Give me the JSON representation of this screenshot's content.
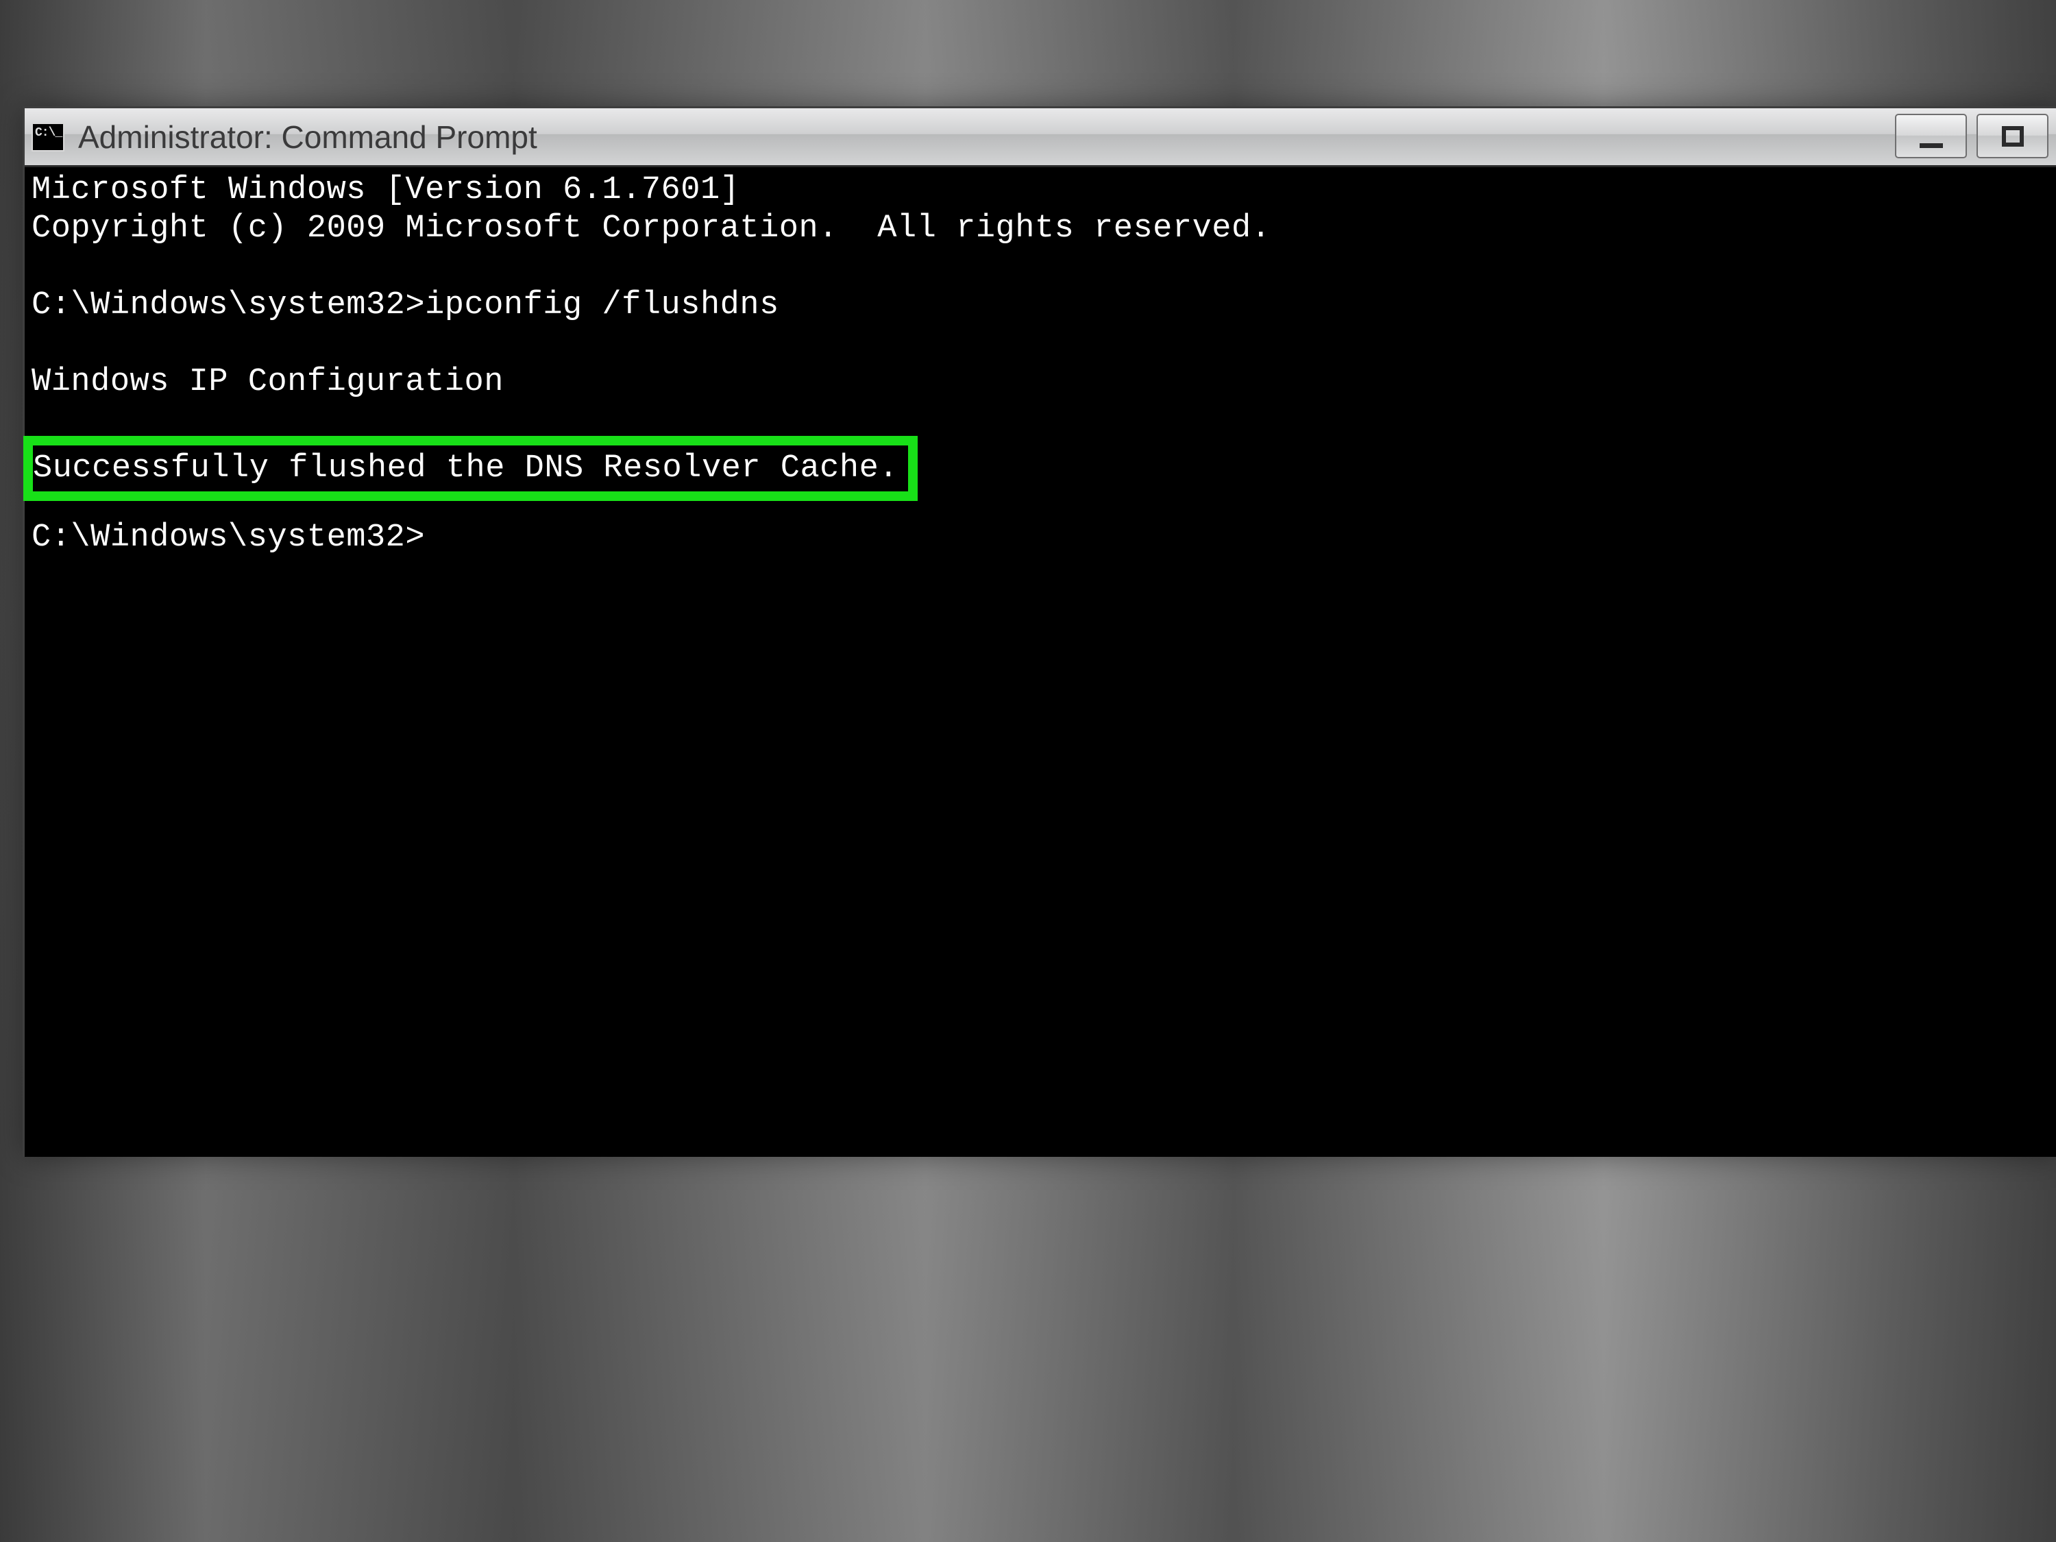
{
  "window": {
    "title": "Administrator: Command Prompt"
  },
  "console": {
    "line1": "Microsoft Windows [Version 6.1.7601]",
    "line2": "Copyright (c) 2009 Microsoft Corporation.  All rights reserved.",
    "line3": "C:\\Windows\\system32>ipconfig /flushdns",
    "line4": "Windows IP Configuration",
    "line5": "Successfully flushed the DNS Resolver Cache.",
    "line6": "C:\\Windows\\system32>"
  },
  "highlight_color": "#18e018"
}
